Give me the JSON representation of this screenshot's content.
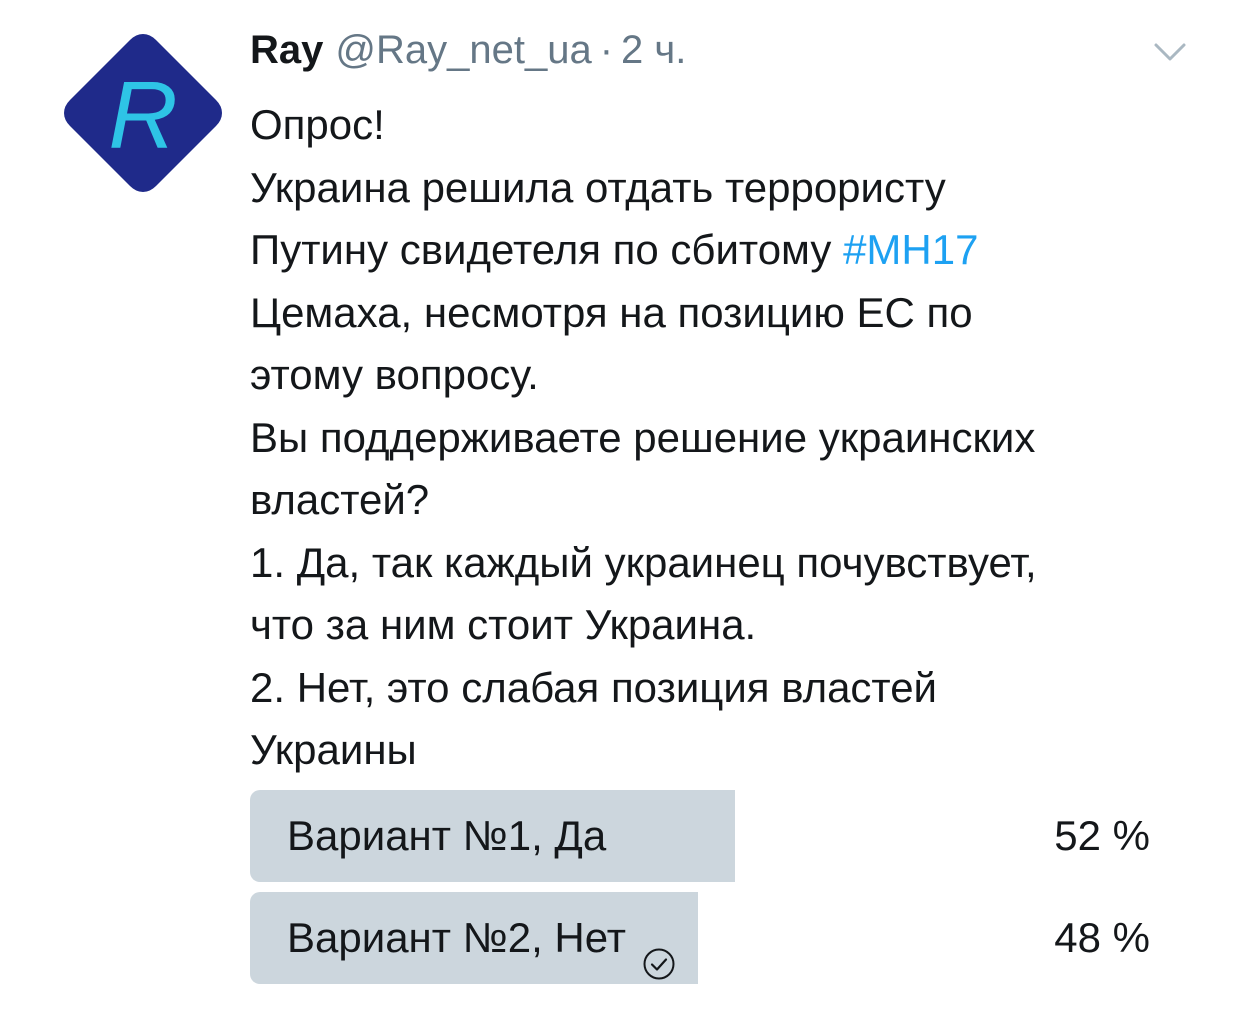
{
  "tweet": {
    "author_name": "Ray",
    "author_handle": "@Ray_net_ua",
    "separator": "·",
    "time": "2 ч.",
    "avatar_letter": "R",
    "avatar_colors": {
      "diamond": "#1f2a8a",
      "letter": "#2ec4e6"
    },
    "menu_icon": "chevron-down-icon",
    "text_lines": [
      "Опрос!",
      "Украина решила отдать террористу",
      "Путину свидетеля по сбитому ",
      "Цемаха, несмотря на позицию ЕС по",
      "этому вопросу.",
      "Вы поддерживаете решение украинских",
      "властей?",
      "1. Да, так каждый украинец почувствует,",
      "что за ним стоит Украина.",
      "2. Нет, это слабая позиция властей",
      "Украины"
    ],
    "hashtag": "#MH17",
    "hashtag_color": "#1da1f2"
  },
  "poll": {
    "options": [
      {
        "label": "Вариант №1, Да",
        "percent_text": "52 %",
        "fraction": 0.52,
        "selected": false
      },
      {
        "label": "Вариант №2, Нет",
        "percent_text": "48 %",
        "fraction": 0.48,
        "selected": true
      }
    ],
    "bar_color": "#ccd6dd",
    "selected_icon": "check-circle-icon"
  }
}
